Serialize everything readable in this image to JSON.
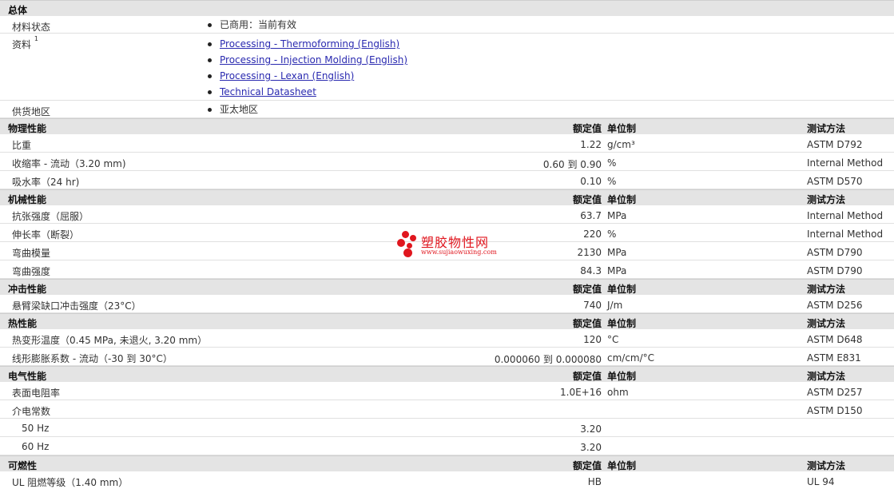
{
  "overview": {
    "title": "总体",
    "rows": [
      {
        "name": "材料状态",
        "items": [
          "已商用：当前有效"
        ]
      },
      {
        "name": "资料",
        "note": "1",
        "links": [
          "Processing - Thermoforming (English)",
          "Processing - Injection Molding (English)",
          "Processing - Lexan (English)",
          "Technical Datasheet"
        ]
      },
      {
        "name": "供货地区",
        "items": [
          "亚太地区"
        ]
      }
    ]
  },
  "column_headers": {
    "value": "额定值",
    "unit": "单位制",
    "method": "测试方法"
  },
  "sections": [
    {
      "title": "物理性能",
      "rows": [
        {
          "name": "比重",
          "value": "1.22",
          "unit": "g/cm³",
          "method": "ASTM D792"
        },
        {
          "name": "收缩率  - 流动（3.20 mm)",
          "value": "0.60 到  0.90",
          "unit": "%",
          "method": "Internal Method"
        },
        {
          "name": "吸水率（24 hr)",
          "value": "0.10",
          "unit": "%",
          "method": "ASTM D570"
        }
      ]
    },
    {
      "title": "机械性能",
      "rows": [
        {
          "name": "抗张强度（屈服）",
          "value": "63.7",
          "unit": "MPa",
          "method": "Internal Method"
        },
        {
          "name": "伸长率（断裂）",
          "value": "220",
          "unit": "%",
          "method": "Internal Method"
        },
        {
          "name": "弯曲模量",
          "value": "2130",
          "unit": "MPa",
          "method": "ASTM D790"
        },
        {
          "name": "弯曲强度",
          "value": "84.3",
          "unit": "MPa",
          "method": "ASTM D790"
        }
      ]
    },
    {
      "title": "冲击性能",
      "rows": [
        {
          "name": "悬臂梁缺口冲击强度（23°C）",
          "value": "740",
          "unit": "J/m",
          "method": "ASTM D256"
        }
      ]
    },
    {
      "title": "热性能",
      "rows": [
        {
          "name": "热变形温度（0.45 MPa, 未退火, 3.20 mm）",
          "value": "120",
          "unit": "°C",
          "method": "ASTM D648"
        },
        {
          "name": "线形膨胀系数  - 流动（-30 到  30°C）",
          "value": "0.000060 到  0.000080",
          "unit": "cm/cm/°C",
          "method": "ASTM E831"
        }
      ]
    },
    {
      "title": "电气性能",
      "rows": [
        {
          "name": "表面电阻率",
          "value": "1.0E+16",
          "unit": "ohm",
          "method": "ASTM D257"
        },
        {
          "name": "介电常数",
          "value": "",
          "unit": "",
          "method": "ASTM D150"
        },
        {
          "name": "50 Hz",
          "sub": true,
          "value": "3.20",
          "unit": "",
          "method": ""
        },
        {
          "name": "60 Hz",
          "sub": true,
          "value": "3.20",
          "unit": "",
          "method": ""
        }
      ]
    },
    {
      "title": "可燃性",
      "rows": [
        {
          "name": "UL 阻燃等级（1.40 mm）",
          "value": "HB",
          "unit": "",
          "method": "UL 94"
        }
      ]
    }
  ],
  "watermark": {
    "name": "塑胶物性网",
    "url": "www.sujiaowuxing.com",
    "color": "#e0161e"
  }
}
